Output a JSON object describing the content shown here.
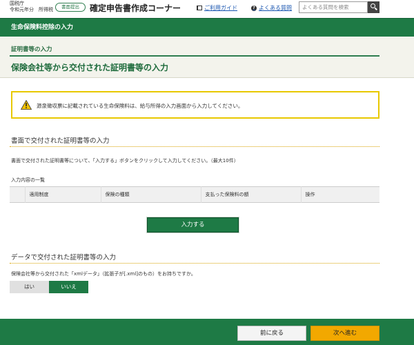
{
  "header": {
    "agency_line1": "国税庁",
    "agency_line2": "令和元年分　所得税",
    "mode_badge": "書面提出",
    "app_title": "確定申告書作成コーナー",
    "guide_link": "ご利用ガイド",
    "faq_link": "よくある質問",
    "search_placeholder": "よくある質問を検索"
  },
  "section_bar": {
    "title": "生命保険料控除の入力"
  },
  "sub_header": {
    "breadcrumb": "証明書等の入力",
    "page_title": "保険会社等から交付された証明書等の入力"
  },
  "warning": {
    "text": "源泉徴収票に記載されている生命保険料は、給与所得の入力画面から入力してください。"
  },
  "paper_section": {
    "title": "書面で交付された証明書等の入力",
    "description": "書面で交付された証明書等について、「入力する」ボタンをクリックして入力してください。（最大10件）",
    "list_label": "入力内容の一覧",
    "columns": [
      "適用制度",
      "保険の種類",
      "支払った保険料の額",
      "操作"
    ],
    "enter_button": "入力する"
  },
  "data_section": {
    "title": "データで交付された証明書等の入力",
    "question": "保険会社等から交付された「xmlデータ」（拡張子が[.xml]のもの）をお持ちですか。",
    "yes_label": "はい",
    "no_label": "いいえ",
    "selected": "いいえ"
  },
  "footer": {
    "back_button": "前に戻る",
    "next_button": "次へ進む"
  },
  "colors": {
    "primary_green": "#1e7a45",
    "warning_yellow": "#e8c800",
    "next_orange": "#f2a800"
  }
}
